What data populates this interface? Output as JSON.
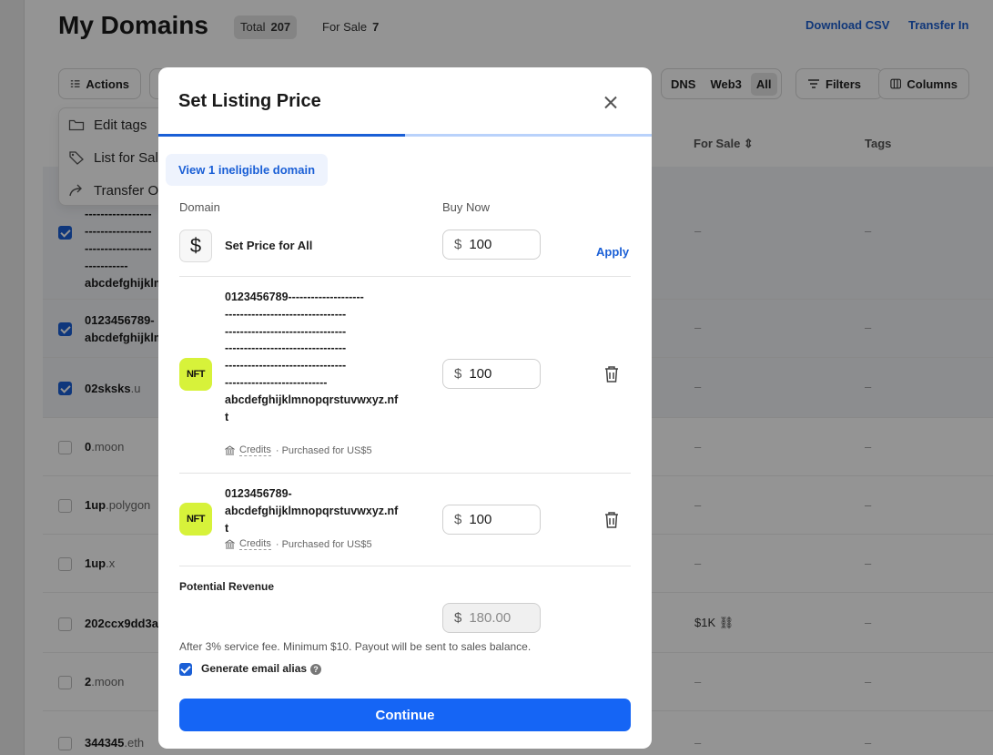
{
  "header": {
    "title": "My Domains",
    "total_label": "Total",
    "total_value": "207",
    "for_sale_label": "For Sale",
    "for_sale_value": "7",
    "download_csv": "Download CSV",
    "transfer_in": "Transfer In"
  },
  "toolbar": {
    "actions": "Actions",
    "segments": [
      "DNS",
      "Web3",
      "All"
    ],
    "filters": "Filters",
    "columns": "Columns"
  },
  "actions_menu": [
    "Edit tags",
    "List for Sale",
    "Transfer Out"
  ],
  "table": {
    "headers": {
      "for_sale": "For Sale",
      "tags": "Tags"
    },
    "rows": [
      {
        "name_lines": [
          "-----------------",
          "-----------------",
          "-----------------",
          "-----------",
          "abcdefghijklmnop"
        ],
        "tld": "",
        "checked": true,
        "for_sale": "–",
        "tags": "–"
      },
      {
        "name_lines": [
          "0123456789-",
          "abcdefghijklmnop"
        ],
        "tld": "",
        "checked": true,
        "for_sale": "–",
        "tags": "–"
      },
      {
        "name": "02sksks",
        "tld": ".u",
        "checked": true,
        "for_sale": "–",
        "tags": "–"
      },
      {
        "name": "0",
        "tld": ".moon",
        "checked": false,
        "for_sale": "–",
        "tags": "–"
      },
      {
        "name": "1up",
        "tld": ".polygon",
        "checked": false,
        "for_sale": "–",
        "tags": "–"
      },
      {
        "name": "1up",
        "tld": ".x",
        "checked": false,
        "for_sale": "–",
        "tags": "–"
      },
      {
        "name": "202ccx9dd3a",
        "tld": "",
        "checked": false,
        "for_sale": "$1K",
        "tags": "–"
      },
      {
        "name": "2",
        "tld": ".moon",
        "checked": false,
        "for_sale": "–",
        "tags": "–"
      },
      {
        "name": "344345",
        "tld": ".eth",
        "checked": false,
        "for_sale": "–",
        "tags": "–"
      }
    ]
  },
  "modal": {
    "title": "Set Listing Price",
    "ineligible": "View 1 ineligible domain",
    "col_domain": "Domain",
    "col_buy_now": "Buy Now",
    "set_all_label": "Set Price for All",
    "currency": "$",
    "set_all_value": "100",
    "apply": "Apply",
    "listings": [
      {
        "name_lines": [
          "0123456789--------------------",
          "--------------------------------",
          "--------------------------------",
          "--------------------------------",
          "--------------------------------",
          "---------------------------",
          "abcdefghijklmnopqrstuvwxyz.nf",
          "t"
        ],
        "icon_text": "NFT",
        "price": "100",
        "meta_credits": "Credits",
        "meta_purchase": "· Purchased for US$5"
      },
      {
        "name_lines": [
          "0123456789-",
          "abcdefghijklmnopqrstuvwxyz.nf",
          "t"
        ],
        "icon_text": "NFT",
        "price": "100",
        "meta_credits": "Credits",
        "meta_purchase": "· Purchased for US$5"
      }
    ],
    "revenue_label": "Potential Revenue",
    "revenue_value": "180.00",
    "fee_note": "After 3% service fee. Minimum $10. Payout will be sent to sales balance.",
    "email_alias": "Generate email alias",
    "help": "?",
    "continue": "Continue"
  }
}
